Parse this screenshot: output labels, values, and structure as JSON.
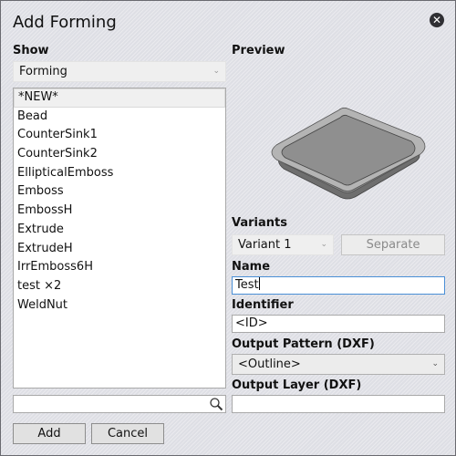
{
  "dialog": {
    "title": "Add Forming",
    "close_icon": "close-circle-icon"
  },
  "show": {
    "label": "Show",
    "selected": "Forming"
  },
  "list": {
    "items": [
      {
        "label": "*NEW*",
        "selected": true
      },
      {
        "label": "Bead"
      },
      {
        "label": "CounterSink1"
      },
      {
        "label": "CounterSink2"
      },
      {
        "label": "EllipticalEmboss"
      },
      {
        "label": "Emboss"
      },
      {
        "label": "EmbossH"
      },
      {
        "label": "Extrude"
      },
      {
        "label": "ExtrudeH"
      },
      {
        "label": "IrrEmboss6H"
      },
      {
        "label": "test ×2"
      },
      {
        "label": "WeldNut"
      }
    ]
  },
  "search": {
    "value": "",
    "icon": "search-icon"
  },
  "buttons": {
    "add": "Add",
    "cancel": "Cancel"
  },
  "preview": {
    "label": "Preview"
  },
  "variants": {
    "label": "Variants",
    "selected": "Variant 1",
    "separate_label": "Separate"
  },
  "name": {
    "label": "Name",
    "value": "Test"
  },
  "identifier": {
    "label": "Identifier",
    "value": "<ID>"
  },
  "output_pattern": {
    "label": "Output Pattern (DXF)",
    "selected": "<Outline>"
  },
  "output_layer": {
    "label": "Output Layer (DXF)",
    "value": ""
  }
}
